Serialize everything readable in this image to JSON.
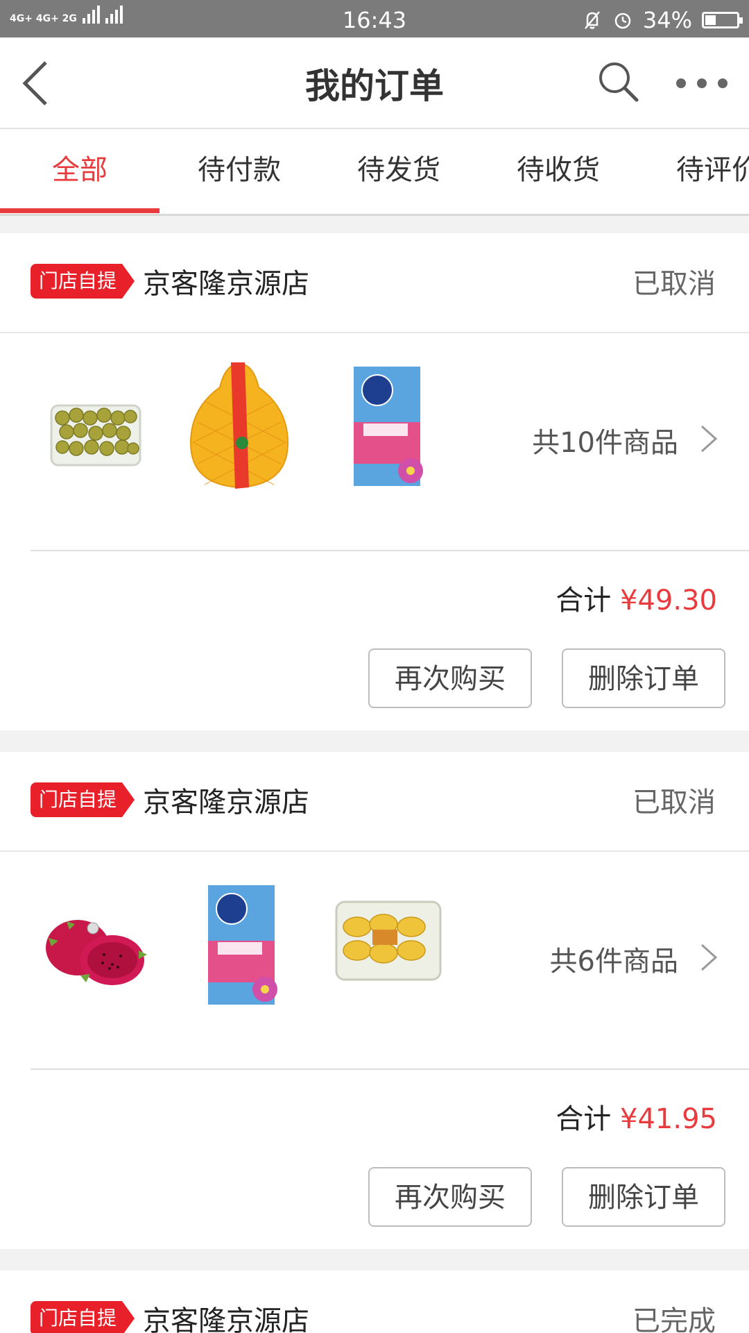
{
  "status_bar": {
    "network": "4G+ 4G+ 2G",
    "time": "16:43",
    "battery": "34%",
    "battery_level": 0.34,
    "icons": [
      "signal-icon",
      "mute-icon",
      "alarm-icon",
      "battery-icon"
    ]
  },
  "header": {
    "title": "我的订单",
    "back_icon": "chevron-left-icon",
    "search_icon": "search-icon",
    "more_icon": "more-dots-icon"
  },
  "tabs": [
    {
      "label": "全部",
      "active": true
    },
    {
      "label": "待付款",
      "active": false
    },
    {
      "label": "待发货",
      "active": false
    },
    {
      "label": "待收货",
      "active": false
    },
    {
      "label": "待评价",
      "active": false
    }
  ],
  "orders": [
    {
      "badge": "门店自提",
      "store": "京客隆京源店",
      "status": "已取消",
      "items": [
        "longan-image",
        "pomelo-image",
        "vinda-tissue-image"
      ],
      "count_text": "共10件商品",
      "total_label": "合计",
      "total": "¥49.30",
      "buttons": {
        "rebuy": "再次购买",
        "delete": "删除订单"
      }
    },
    {
      "badge": "门店自提",
      "store": "京客隆京源店",
      "status": "已取消",
      "items": [
        "dragon-fruit-image",
        "vinda-tissue-image",
        "mango-box-image"
      ],
      "count_text": "共6件商品",
      "total_label": "合计",
      "total": "¥41.95",
      "buttons": {
        "rebuy": "再次购买",
        "delete": "删除订单"
      }
    },
    {
      "badge": "门店自提",
      "store": "京客隆京源店",
      "status": "已完成"
    }
  ],
  "colors": {
    "accent": "#e93b3d",
    "badge": "#e8202a",
    "status_bar": "#7b7b7b"
  }
}
